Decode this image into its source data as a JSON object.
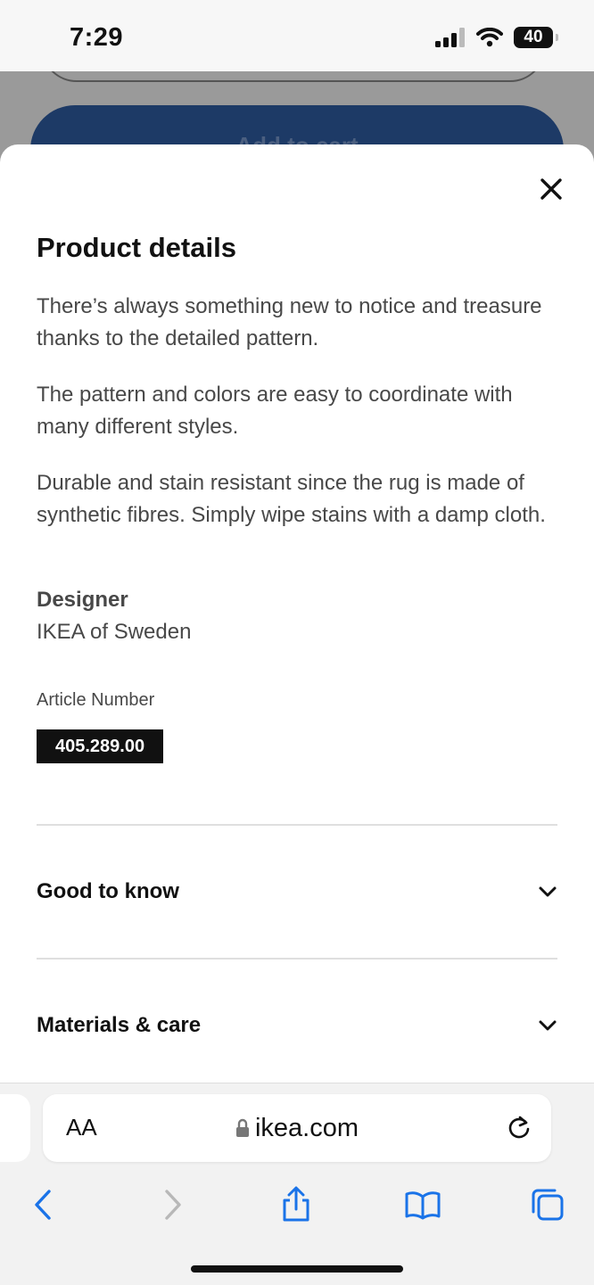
{
  "status_bar": {
    "time": "7:29",
    "battery": "40"
  },
  "underlay": {
    "cart_button_label": "Add to cart"
  },
  "sheet": {
    "title": "Product details",
    "paragraphs": [
      "There’s always something new to notice and treasure thanks to the detailed pattern.",
      "The pattern and colors are easy to coordinate with many different styles.",
      "Durable and stain resistant since the rug is made of synthetic fibres. Simply wipe stains with a damp cloth."
    ],
    "designer_label": "Designer",
    "designer_value": "IKEA of Sweden",
    "article_label": "Article Number",
    "article_number": "405.289.00",
    "accordions": [
      {
        "label": "Good to know",
        "icon": "chevron-down-icon"
      },
      {
        "label": "Materials & care",
        "icon": "chevron-down-icon"
      }
    ]
  },
  "browser": {
    "text_size_label": "AA",
    "url": "ikea.com",
    "toolbar": [
      "back-icon",
      "forward-icon",
      "share-icon",
      "bookmarks-icon",
      "tabs-icon"
    ]
  },
  "colors": {
    "accent": "#1d3a66",
    "ios_blue": "#1a73e8",
    "text": "#111111",
    "body_text": "#484848"
  }
}
